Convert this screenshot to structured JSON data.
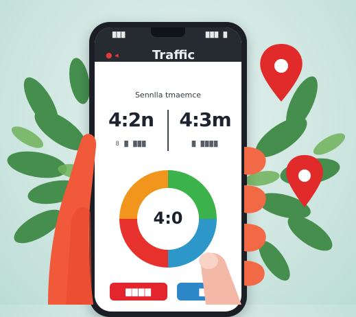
{
  "app": {
    "title": "Traffic"
  },
  "status_bar": {
    "time": "▇▇▇",
    "icons": "▇▇▇ ▇"
  },
  "stats": {
    "subtitle": "Sennlla tmaemce",
    "left": {
      "value": "4:2n",
      "label": "8 ▇ ▇▇▇"
    },
    "right": {
      "value": "4:3m",
      "label": "▇ ▇▇▇▇"
    }
  },
  "gauge": {
    "value": "4:0"
  },
  "buttons": {
    "left_label": "▇▇▇▇",
    "right_label": "▇▇"
  },
  "colors": {
    "accent_red": "#e3262e",
    "accent_blue": "#2d86c7",
    "gauge_green": "#3bb34a",
    "gauge_orange": "#f2951c",
    "gauge_red": "#e7312c",
    "gauge_teal": "#2c97c8",
    "pin_red": "#e12a2a"
  },
  "icons": {
    "back": "back-icon",
    "pin": "map-pin-icon"
  }
}
